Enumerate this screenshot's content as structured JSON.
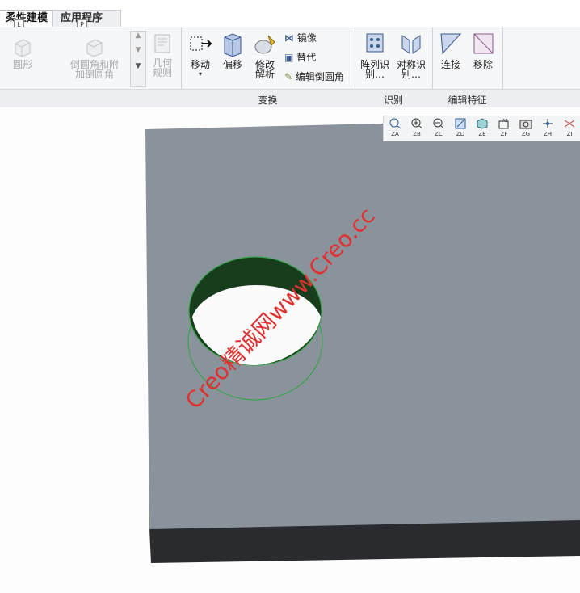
{
  "tabs": [
    {
      "label": "柔性建模",
      "keytip": "L",
      "active": true
    },
    {
      "label": "应用程序",
      "keytip": "P",
      "active": false
    }
  ],
  "ribbon": {
    "round_label": "圆形",
    "chamfer_label": "倒圆角和附加倒圆角",
    "geometry_rule_label": "几何规则",
    "move_label": "移动",
    "offset_label": "偏移",
    "modify_label": "修改解析",
    "mirror_label": "镜像",
    "substitute_label": "替代",
    "edit_round_label": "编辑倒圆角",
    "pattern_label": "阵列识别…",
    "symmetry_label": "对称识别…",
    "connect_label": "连接",
    "remove_label": "移除",
    "group_transform": "变换",
    "group_recognize": "识别",
    "group_edit_feature": "编辑特征"
  },
  "view_toolbar": [
    "ZA",
    "ZB",
    "ZC",
    "ZD",
    "ZE",
    "ZF",
    "ZG",
    "ZH",
    "ZI"
  ],
  "watermark": "Creo精诚网www.Creo.cc",
  "colors": {
    "plate": "#8a939c",
    "plate_edge": "#292b2e",
    "hole_dark": "#173d1c",
    "accent": "#36a447"
  }
}
